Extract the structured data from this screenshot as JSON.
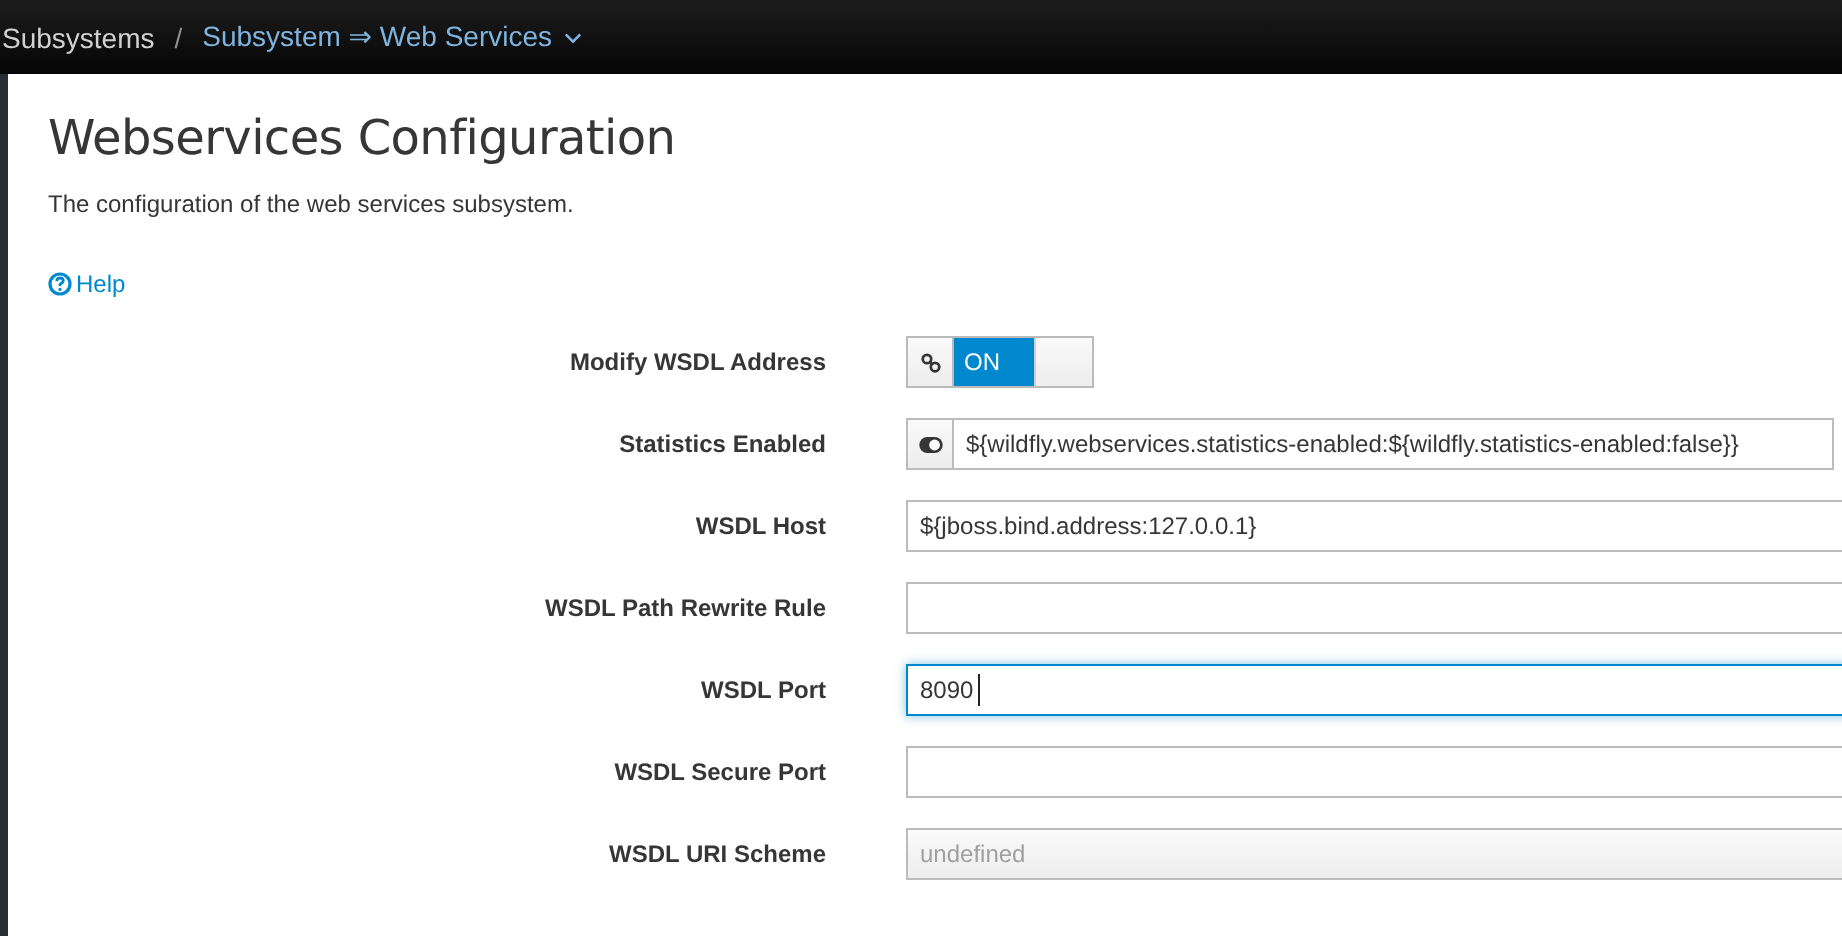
{
  "breadcrumb": {
    "parent": "Subsystems",
    "separator": "/",
    "current": "Subsystem ⇒ Web Services"
  },
  "title": "Webservices Configuration",
  "description": "The configuration of the web services subsystem.",
  "help": "Help",
  "fields": [
    {
      "kind": "switch",
      "label": "Modify WSDL Address",
      "on": true,
      "value": "ON"
    },
    {
      "kind": "expression",
      "label": "Statistics Enabled",
      "value": "${wildfly.webservices.statistics-enabled:${wildfly.statistics-enabled:false}}"
    },
    {
      "kind": "text",
      "label": "WSDL Host",
      "value": "${jboss.bind.address:127.0.0.1}",
      "focused": false,
      "disabled": false
    },
    {
      "kind": "text",
      "label": "WSDL Path Rewrite Rule",
      "focused": false,
      "disabled": false
    },
    {
      "kind": "text",
      "label": "WSDL Port",
      "value": "8090",
      "focused": true,
      "disabled": false
    },
    {
      "kind": "text",
      "label": "WSDL Secure Port",
      "focused": false,
      "disabled": false
    },
    {
      "kind": "text",
      "label": "WSDL URI Scheme",
      "placeholder": "undefined",
      "focused": false,
      "disabled": true
    }
  ]
}
